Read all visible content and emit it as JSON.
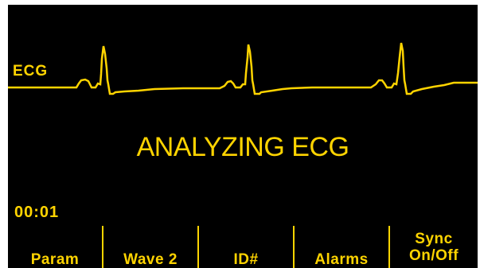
{
  "colors": {
    "background": "#000000",
    "foreground": "#FFD400"
  },
  "waveform": {
    "label": "ECG"
  },
  "status": {
    "message": "ANALYZING ECG"
  },
  "timer": {
    "elapsed": "00:01"
  },
  "softkeys": [
    {
      "label": "Param"
    },
    {
      "label": "Wave 2"
    },
    {
      "label": "ID#"
    },
    {
      "label": "Alarms"
    },
    {
      "label_line1": "Sync",
      "label_line2": "On/Off"
    }
  ]
}
